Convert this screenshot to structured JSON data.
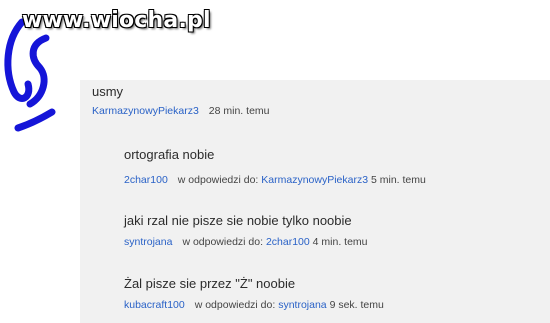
{
  "watermark": "www.wiocha.pl",
  "colors": {
    "link": "#2a62c7",
    "panel": "#f1f1f1",
    "doodle": "#1515d8"
  },
  "comments": [
    {
      "text": "usmy",
      "author": "KarmazynowyPiekarz3",
      "time": "28 min. temu"
    },
    {
      "text": "ortografia nobie",
      "author": "2char100",
      "reply_label": "w odpowiedzi do:",
      "reply_to": "KarmazynowyPiekarz3",
      "time": "5 min. temu"
    },
    {
      "text": "jaki rzal nie pisze sie nobie tylko noobie",
      "author": "syntrojana",
      "reply_label": "w odpowiedzi do:",
      "reply_to": "2char100",
      "time": "4 min. temu"
    },
    {
      "text": "Żal pisze sie przez \"Ż\" noobie",
      "author": "kubacraft100",
      "reply_label": "w odpowiedzi do:",
      "reply_to": "syntrojana",
      "time": "9 sek. temu"
    }
  ]
}
